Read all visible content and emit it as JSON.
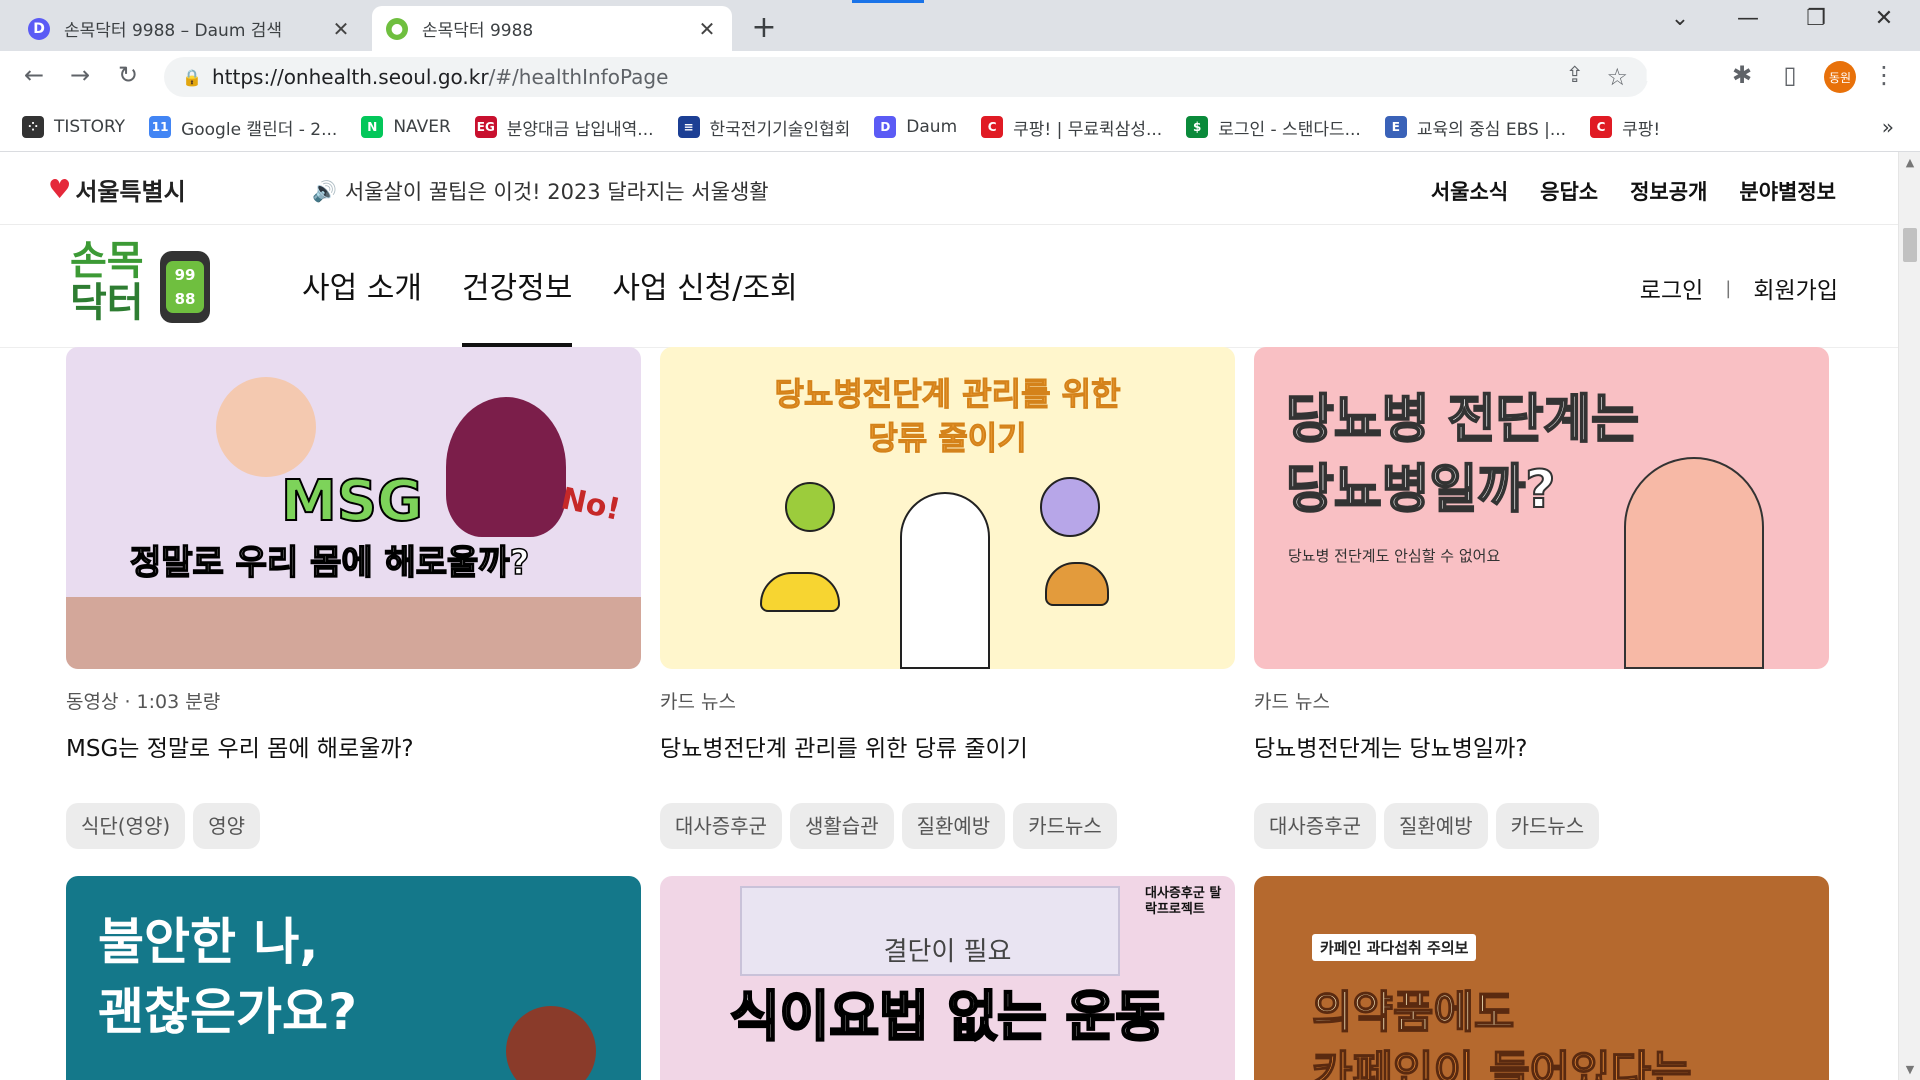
{
  "browser": {
    "tabs": [
      {
        "title": "손목닥터 9988 – Daum 검색",
        "favicon": "daum-icon",
        "close": "✕"
      },
      {
        "title": "손목닥터 9988",
        "favicon": "health-icon",
        "close": "✕"
      }
    ],
    "url_host": "https://onhealth.seoul.go.kr",
    "url_path": "/#/healthInfoPage",
    "profile_label": "동원",
    "extensions": [
      {
        "name": "I",
        "color": "#5f6368"
      },
      {
        "name": "EX",
        "color": "#e8710a"
      }
    ],
    "bookmarks": [
      {
        "label": "TISTORY",
        "color": "#333333",
        "glyph": "⁘"
      },
      {
        "label": "Google 캘린더 - 2...",
        "color": "#4285f4",
        "glyph": "11"
      },
      {
        "label": "NAVER",
        "color": "#03c75a",
        "glyph": "N"
      },
      {
        "label": "분양대금 납입내역...",
        "color": "#c8102e",
        "glyph": "EG"
      },
      {
        "label": "한국전기기술인협회",
        "color": "#1c3f94",
        "glyph": "≡"
      },
      {
        "label": "Daum",
        "color": "#5b5bf5",
        "glyph": "D"
      },
      {
        "label": "쿠팡! | 무료퀵삼성...",
        "color": "#e01b24",
        "glyph": "C"
      },
      {
        "label": "로그인 - 스탠다드...",
        "color": "#0a8a3a",
        "glyph": "$"
      },
      {
        "label": "교육의 중심 EBS |...",
        "color": "#3a62b8",
        "glyph": "E"
      },
      {
        "label": "쿠팡!",
        "color": "#e01b24",
        "glyph": "C"
      }
    ]
  },
  "gov_bar": {
    "logo": "서울특별시",
    "notice": "서울살이 꿀팁은 이것! 2023 달라지는 서울생활",
    "menu": [
      "서울소식",
      "응답소",
      "정보공개",
      "분야별정보"
    ]
  },
  "site": {
    "brand_line1": "손목",
    "brand_line2": "닥터",
    "watch_digits_1": "99",
    "watch_digits_2": "88",
    "nav": [
      "사업 소개",
      "건강정보",
      "사업 신청/조회"
    ],
    "active_nav": "건강정보",
    "login": "로그인",
    "signup": "회원가입"
  },
  "cards": [
    {
      "meta": "동영상 · 1:03 분량",
      "title": "MSG는 정말로 우리 몸에 해로울까?",
      "tags": [
        "식단(영양)",
        "영양"
      ],
      "thumb_line1": "MSG",
      "thumb_line2": "정말로 우리 몸에 해로울까?",
      "thumb_extra": "No!",
      "thumb_bg": "#e9dcf0"
    },
    {
      "meta": "카드 뉴스",
      "title": "당뇨병전단계 관리를 위한 당류 줄이기",
      "tags": [
        "대사증후군",
        "생활습관",
        "질환예방",
        "카드뉴스"
      ],
      "thumb_line1": "당뇨병전단계 관리를 위한",
      "thumb_line2": "당류 줄이기",
      "thumb_bg": "#fff6cc"
    },
    {
      "meta": "카드 뉴스",
      "title": "당뇨병전단계는 당뇨병일까?",
      "tags": [
        "대사증후군",
        "질환예방",
        "카드뉴스"
      ],
      "thumb_line1": "당뇨병 전단계는",
      "thumb_line2": "당뇨병일까?",
      "thumb_sub": "당뇨병 전단계도 안심할 수 없어요",
      "thumb_bg": "#f9c0c4"
    },
    {
      "thumb_line1": "불안한 나,",
      "thumb_line2": "괜찮은가요?",
      "thumb_bg": "#14788a"
    },
    {
      "thumb_line1": "결단이 필요",
      "thumb_line2": "식이요법 없는 운동",
      "thumb_badge": "대사증후군 탈락프로젝트",
      "thumb_bg": "#f1d6e6"
    },
    {
      "thumb_label": "카페인 과다섭취 주의보",
      "thumb_line1": "의약품에도",
      "thumb_line2": "카페인이 들어있다는",
      "thumb_bg": "#b5692e"
    }
  ]
}
